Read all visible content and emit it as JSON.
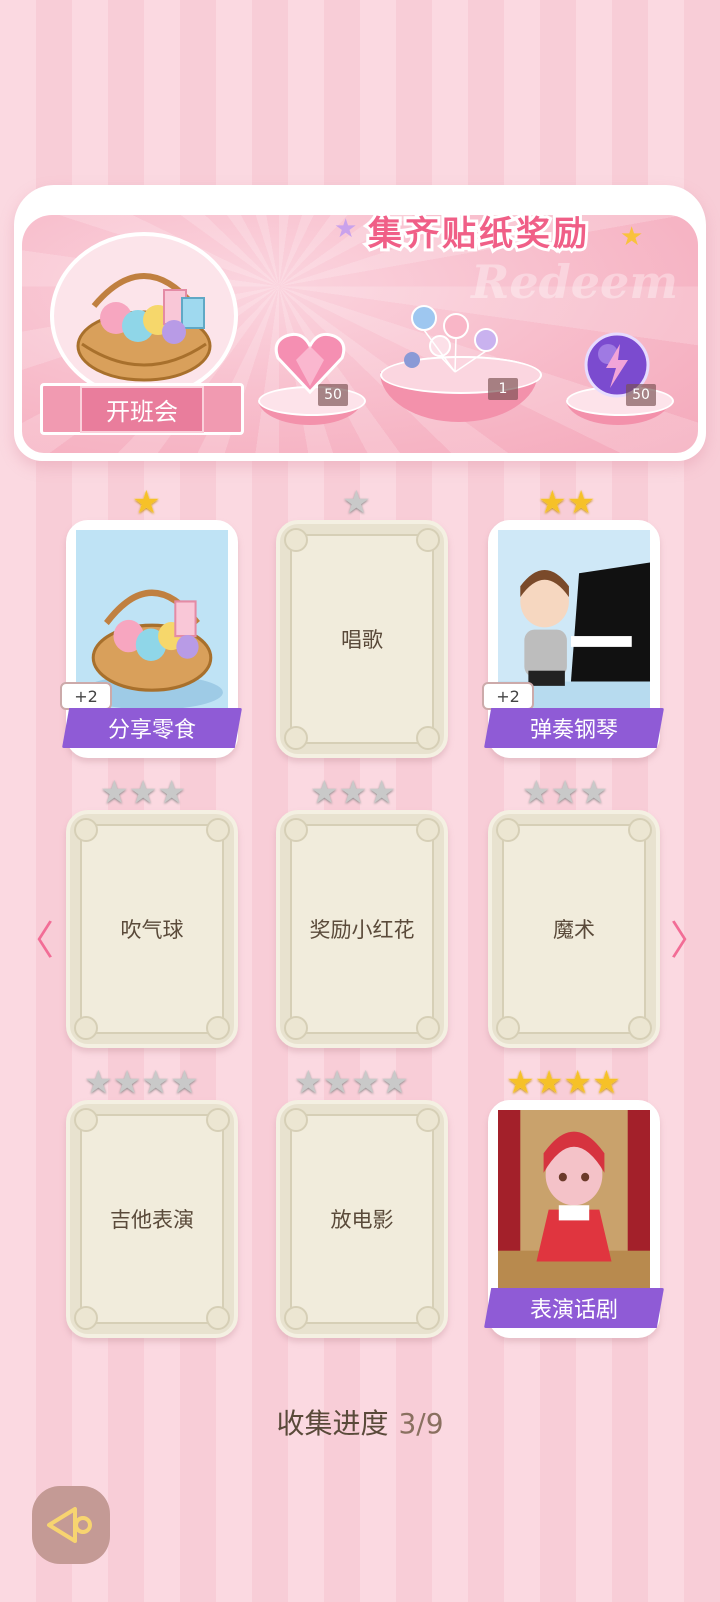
{
  "banner": {
    "title": "集齐贴纸奖励",
    "ghost_text": "Redeem",
    "event_name": "开班会",
    "rewards": [
      {
        "icon": "pink-heart-gem-icon",
        "count": "50"
      },
      {
        "icon": "balloon-bundle-icon",
        "count": "1"
      },
      {
        "icon": "purple-lightning-orb-icon",
        "count": "50"
      }
    ]
  },
  "cards": [
    {
      "label": "分享零食",
      "stars": 1,
      "unlocked": true,
      "bonus": "+2",
      "art": "snack-basket"
    },
    {
      "label": "唱歌",
      "stars": 1,
      "unlocked": false
    },
    {
      "label": "弹奏钢琴",
      "stars": 2,
      "unlocked": true,
      "bonus": "+2",
      "art": "piano-boy"
    },
    {
      "label": "吹气球",
      "stars": 3,
      "unlocked": false
    },
    {
      "label": "奖励小红花",
      "stars": 3,
      "unlocked": false
    },
    {
      "label": "魔术",
      "stars": 3,
      "unlocked": false
    },
    {
      "label": "吉他表演",
      "stars": 4,
      "unlocked": false
    },
    {
      "label": "放电影",
      "stars": 4,
      "unlocked": false
    },
    {
      "label": "表演话剧",
      "stars": 4,
      "unlocked": true,
      "art": "stage-cat-girl"
    }
  ],
  "progress": {
    "label": "收集进度",
    "value": "3/9"
  },
  "colors": {
    "accent": "#f05f87",
    "name_tag": "#8f5bd6",
    "star_gold": "#f6c128",
    "star_grey": "#c9c9c9"
  }
}
